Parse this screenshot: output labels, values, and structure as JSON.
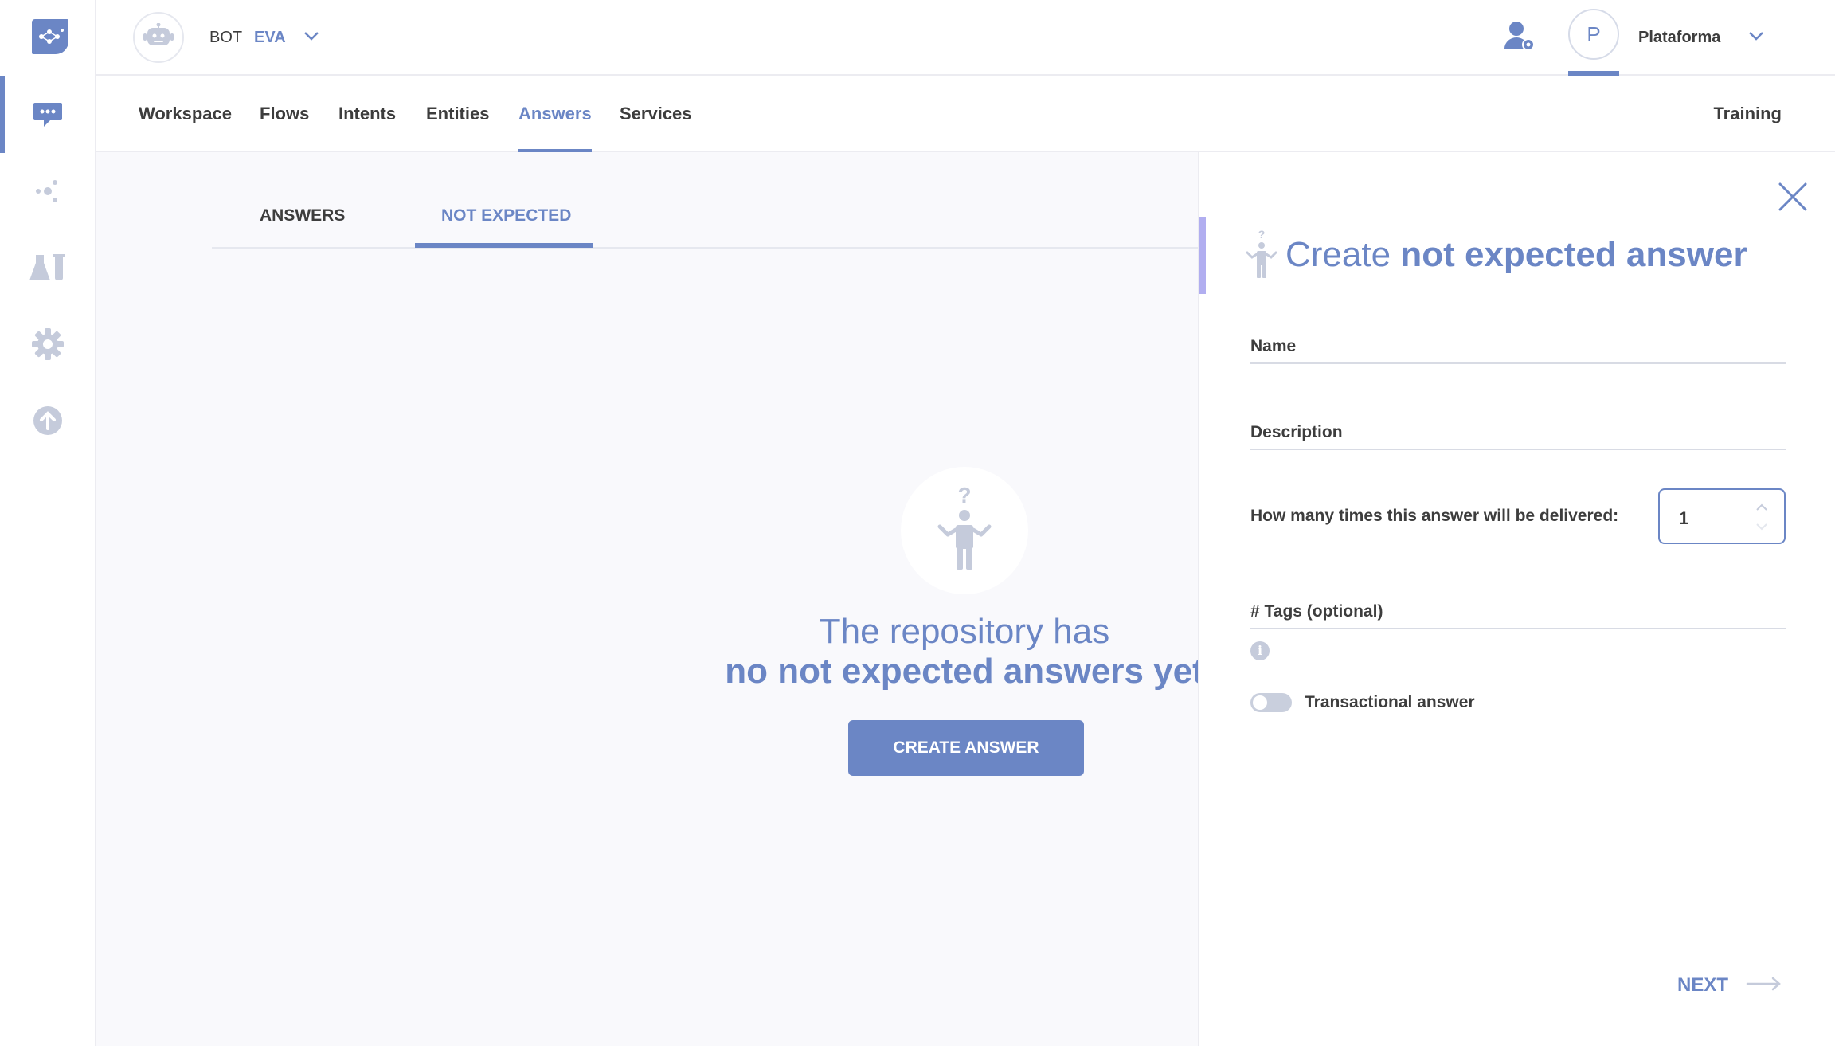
{
  "header": {
    "bot_label": "BOT",
    "bot_name": "EVA",
    "user_initial": "P",
    "org_name": "Plataforma"
  },
  "sidebar": {
    "items": [
      {
        "icon": "chat-bubble-icon",
        "active": true
      },
      {
        "icon": "nodes-icon",
        "active": false
      },
      {
        "icon": "lab-flask-icon",
        "active": false
      },
      {
        "icon": "gear-icon",
        "active": false
      },
      {
        "icon": "upload-arrow-icon",
        "active": false
      }
    ]
  },
  "nav": {
    "tabs": [
      {
        "label": "Workspace"
      },
      {
        "label": "Flows"
      },
      {
        "label": "Intents"
      },
      {
        "label": "Entities"
      },
      {
        "label": "Answers",
        "active": true
      },
      {
        "label": "Services"
      }
    ],
    "training": "Training"
  },
  "subtabs": [
    {
      "label": "ANSWERS"
    },
    {
      "label": "NOT EXPECTED",
      "active": true
    }
  ],
  "empty_state": {
    "line1": "The repository has",
    "line2": "no not expected answers yet",
    "button": "CREATE ANSWER"
  },
  "panel": {
    "title_light": "Create",
    "title_bold": "not expected answer",
    "name_label": "Name",
    "description_label": "Description",
    "delivery_label": "How many times this answer will be delivered:",
    "delivery_value": "1",
    "tags_label": "# Tags (optional)",
    "info_glyph": "i",
    "toggle_label": "Transactional answer",
    "next_label": "NEXT"
  },
  "colors": {
    "accent": "#6b86c5",
    "panel_accent": "#b1aef0",
    "background": "#f9f9fc"
  }
}
